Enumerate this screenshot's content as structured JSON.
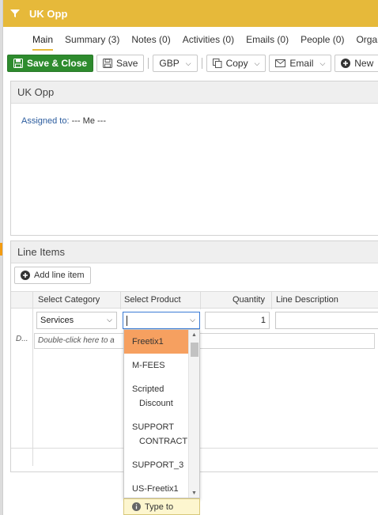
{
  "window": {
    "title": "UK Opp"
  },
  "tabs": [
    {
      "label": "Main"
    },
    {
      "label": "Summary (3)"
    },
    {
      "label": "Notes (0)"
    },
    {
      "label": "Activities (0)"
    },
    {
      "label": "Emails (0)"
    },
    {
      "label": "People (0)"
    },
    {
      "label": "Organ"
    }
  ],
  "toolbar": {
    "save_close": "Save & Close",
    "save": "Save",
    "currency": "GBP",
    "copy": "Copy",
    "email": "Email",
    "new": "New"
  },
  "record": {
    "heading": "UK Opp",
    "assigned_label": "Assigned to:",
    "assigned_value": "--- Me ---"
  },
  "line_items": {
    "heading": "Line Items",
    "add_label": "Add line item",
    "columns": [
      "Select Category",
      "Select Product",
      "Quantity",
      "Line Description"
    ],
    "row": {
      "category": "Services",
      "product": "",
      "quantity": "1",
      "description": ""
    },
    "hint_prefix": "D...",
    "hint_text": "Double-click here to a"
  },
  "product_dropdown": {
    "options": [
      {
        "line1": "Freetix1",
        "line2": ""
      },
      {
        "line1": "M-FEES",
        "line2": ""
      },
      {
        "line1": "Scripted",
        "line2": "Discount"
      },
      {
        "line1": "SUPPORT",
        "line2": "CONTRACT"
      },
      {
        "line1": "SUPPORT_3",
        "line2": ""
      },
      {
        "line1": "US-Freetix1",
        "line2": ""
      }
    ],
    "selected": "Freetix1",
    "type_hint": "Type to"
  },
  "colors": {
    "titlebar": "#e6b93a",
    "primary": "#2e8b2e",
    "selected_option": "#f6a060",
    "label_blue": "#2b5c9e"
  }
}
